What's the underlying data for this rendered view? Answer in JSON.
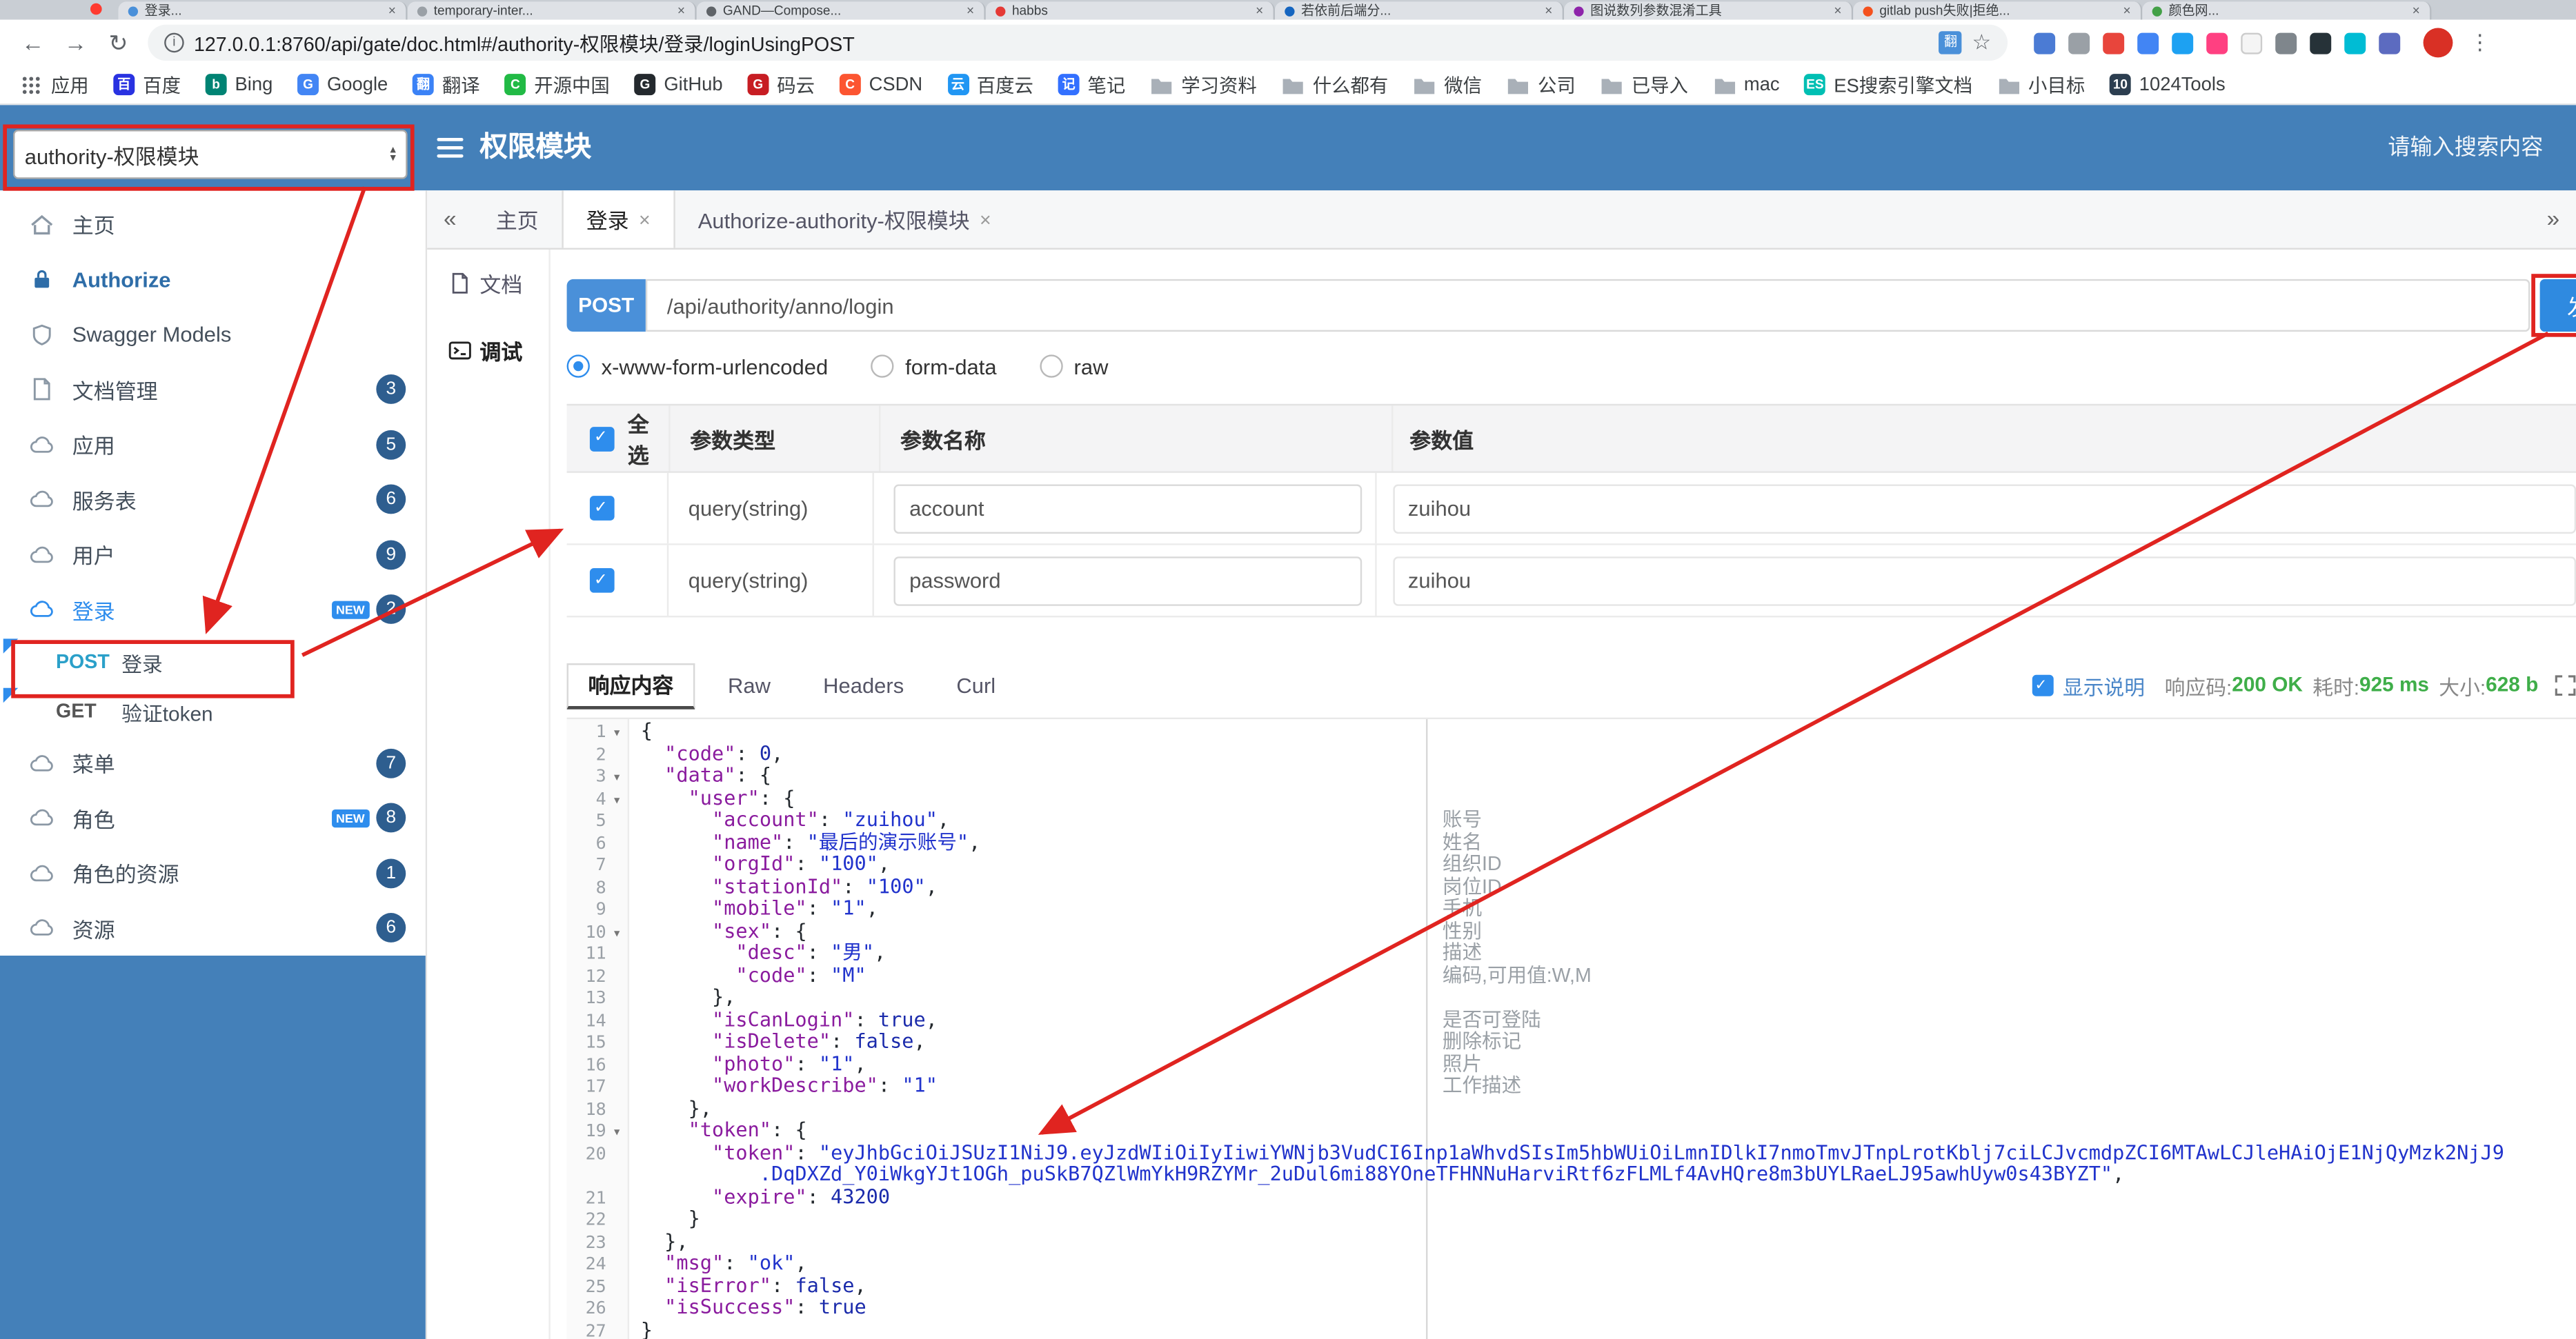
{
  "browser": {
    "tab_strip": [
      {
        "title": "登录...",
        "color": "#4a90d9"
      },
      {
        "title": "temporary-inter...",
        "color": "#9aa0a6"
      },
      {
        "title": "GAND—Compose...",
        "color": "#5f6368"
      },
      {
        "title": "habbs",
        "color": "#e53935"
      },
      {
        "title": "若依前后端分...",
        "color": "#1565c0"
      },
      {
        "title": "图说数列参数混淆工具",
        "color": "#8e24aa"
      },
      {
        "title": "gitlab push失败|拒绝...",
        "color": "#f4511e"
      },
      {
        "title": "颜色网...",
        "color": "#43a047"
      }
    ],
    "close_glyph": "×",
    "url": "127.0.0.1:8760/api/gate/doc.html#/authority-权限模块/登录/loginUsingPOST",
    "bookmarks": [
      {
        "icon": "grid",
        "label": "应用"
      },
      {
        "icon": "letter",
        "letter": "百",
        "color": "#2932e1",
        "label": "百度"
      },
      {
        "icon": "letter",
        "letter": "b",
        "color": "#008373",
        "label": "Bing"
      },
      {
        "icon": "letter",
        "letter": "G",
        "color": "#4285f4",
        "label": "Google"
      },
      {
        "icon": "letter",
        "letter": "翻",
        "color": "#3b82f6",
        "label": "翻译"
      },
      {
        "icon": "letter",
        "letter": "C",
        "color": "#21ba45",
        "label": "开源中国"
      },
      {
        "icon": "letter",
        "letter": "G",
        "color": "#24292e",
        "label": "GitHub"
      },
      {
        "icon": "letter",
        "letter": "G",
        "color": "#c71d23",
        "label": "码云"
      },
      {
        "icon": "letter",
        "letter": "C",
        "color": "#fc5531",
        "label": "CSDN"
      },
      {
        "icon": "letter",
        "letter": "云",
        "color": "#2196f3",
        "label": "百度云"
      },
      {
        "icon": "letter",
        "letter": "记",
        "color": "#3370ff",
        "label": "笔记"
      },
      {
        "icon": "folder",
        "label": "学习资料"
      },
      {
        "icon": "folder",
        "label": "什么都有"
      },
      {
        "icon": "folder",
        "label": "微信"
      },
      {
        "icon": "folder",
        "label": "公司"
      },
      {
        "icon": "folder",
        "label": "已导入"
      },
      {
        "icon": "folder",
        "label": "mac"
      },
      {
        "icon": "letter",
        "letter": "ES",
        "color": "#00bfb3",
        "label": "ES搜索引擎文档"
      },
      {
        "icon": "folder",
        "label": "小目标"
      },
      {
        "icon": "letter",
        "letter": "10",
        "color": "#2c3e50",
        "label": "1024Tools"
      }
    ],
    "extensions": [
      "#4b7bd4",
      "#9aa0a6",
      "#e8453c",
      "#4285f4",
      "#1da1f2",
      "#ff4081",
      "#f5f5f5",
      "#7f868c",
      "#263238",
      "#00bcd4",
      "#5c6bc0"
    ]
  },
  "header": {
    "module_select": "authority-权限模块",
    "title": "权限模块",
    "search_placeholder": "请输入搜索内容"
  },
  "sidebar": {
    "new_label": "NEW",
    "items": [
      {
        "icon": "home",
        "label": "主页"
      },
      {
        "icon": "lock",
        "label": "Authorize",
        "style": "auth"
      },
      {
        "icon": "shield",
        "label": "Swagger Models"
      },
      {
        "icon": "doc",
        "label": "文档管理",
        "badge": "3"
      },
      {
        "icon": "cloud",
        "label": "应用",
        "badge": "5"
      },
      {
        "icon": "cloud",
        "label": "服务表",
        "badge": "6"
      },
      {
        "icon": "cloud",
        "label": "用户",
        "badge": "9"
      },
      {
        "icon": "cloud",
        "label": "登录",
        "badge": "2",
        "new": true,
        "active": true
      },
      {
        "method": "POST",
        "label": "登录",
        "flag": true,
        "boxed": true
      },
      {
        "method": "GET",
        "label": "验证token",
        "flag": true
      },
      {
        "icon": "cloud",
        "label": "菜单",
        "badge": "7"
      },
      {
        "icon": "cloud",
        "label": "角色",
        "badge": "8",
        "new": true
      },
      {
        "icon": "cloud",
        "label": "角色的资源",
        "badge": "1"
      },
      {
        "icon": "cloud",
        "label": "资源",
        "badge": "6"
      }
    ]
  },
  "tabs": {
    "left_arrow": "«",
    "right_arrow": "»",
    "close_glyph": "×",
    "items": [
      {
        "label": "主页"
      },
      {
        "label": "登录",
        "closable": true,
        "active": true
      },
      {
        "label": "Authorize-authority-权限模块",
        "closable": true
      }
    ]
  },
  "view_tabs": {
    "doc": "文档",
    "debug": "调试"
  },
  "request": {
    "method": "POST",
    "url": "/api/authority/anno/login",
    "send_label": "发送",
    "content_types": [
      {
        "label": "x-www-form-urlencoded",
        "selected": true
      },
      {
        "label": "form-data"
      },
      {
        "label": "raw"
      }
    ]
  },
  "params": {
    "headers": {
      "all": "全选",
      "type": "参数类型",
      "name": "参数名称",
      "value": "参数值"
    },
    "rows": [
      {
        "checked": true,
        "type": "query(string)",
        "name": "account",
        "value": "zuihou"
      },
      {
        "checked": true,
        "type": "query(string)",
        "name": "password",
        "value": "zuihou"
      }
    ]
  },
  "response": {
    "tabs": [
      {
        "label": "响应内容",
        "active": true
      },
      {
        "label": "Raw"
      },
      {
        "label": "Headers"
      },
      {
        "label": "Curl"
      }
    ],
    "show_desc": "显示说明",
    "meta": [
      {
        "label": "响应码:",
        "value": "200 OK"
      },
      {
        "label": "耗时:",
        "value": "925 ms"
      },
      {
        "label": "大小:",
        "value": "628 b"
      }
    ]
  },
  "code": {
    "fold_glyph": "▾",
    "rows": [
      {
        "ln": "1",
        "fold": true,
        "segs": [
          [
            "p",
            "{"
          ]
        ]
      },
      {
        "ln": "2",
        "segs": [
          [
            "p",
            "  "
          ],
          [
            "k",
            "\"code\""
          ],
          [
            "p",
            ": "
          ],
          [
            "n",
            "0"
          ],
          [
            "p",
            ","
          ]
        ]
      },
      {
        "ln": "3",
        "fold": true,
        "segs": [
          [
            "p",
            "  "
          ],
          [
            "k",
            "\"data\""
          ],
          [
            "p",
            ": {"
          ]
        ]
      },
      {
        "ln": "4",
        "fold": true,
        "segs": [
          [
            "p",
            "    "
          ],
          [
            "k",
            "\"user\""
          ],
          [
            "p",
            ": {"
          ]
        ]
      },
      {
        "ln": "5",
        "anno": "账号",
        "segs": [
          [
            "p",
            "      "
          ],
          [
            "k",
            "\"account\""
          ],
          [
            "p",
            ": "
          ],
          [
            "s",
            "\"zuihou\""
          ],
          [
            "p",
            ","
          ]
        ]
      },
      {
        "ln": "6",
        "anno": "姓名",
        "segs": [
          [
            "p",
            "      "
          ],
          [
            "k",
            "\"name\""
          ],
          [
            "p",
            ": "
          ],
          [
            "s",
            "\"最后的演示账号\""
          ],
          [
            "p",
            ","
          ]
        ]
      },
      {
        "ln": "7",
        "anno": "组织ID",
        "segs": [
          [
            "p",
            "      "
          ],
          [
            "k",
            "\"orgId\""
          ],
          [
            "p",
            ": "
          ],
          [
            "s",
            "\"100\""
          ],
          [
            "p",
            ","
          ]
        ]
      },
      {
        "ln": "8",
        "anno": "岗位ID",
        "segs": [
          [
            "p",
            "      "
          ],
          [
            "k",
            "\"stationId\""
          ],
          [
            "p",
            ": "
          ],
          [
            "s",
            "\"100\""
          ],
          [
            "p",
            ","
          ]
        ]
      },
      {
        "ln": "9",
        "anno": "手机",
        "segs": [
          [
            "p",
            "      "
          ],
          [
            "k",
            "\"mobile\""
          ],
          [
            "p",
            ": "
          ],
          [
            "s",
            "\"1\""
          ],
          [
            "p",
            ","
          ]
        ]
      },
      {
        "ln": "10",
        "fold": true,
        "anno": "性别",
        "segs": [
          [
            "p",
            "      "
          ],
          [
            "k",
            "\"sex\""
          ],
          [
            "p",
            ": {"
          ]
        ]
      },
      {
        "ln": "11",
        "anno": "描述",
        "segs": [
          [
            "p",
            "        "
          ],
          [
            "k",
            "\"desc\""
          ],
          [
            "p",
            ": "
          ],
          [
            "s",
            "\"男\""
          ],
          [
            "p",
            ","
          ]
        ]
      },
      {
        "ln": "12",
        "anno": "编码,可用值:W,M",
        "segs": [
          [
            "p",
            "        "
          ],
          [
            "k",
            "\"code\""
          ],
          [
            "p",
            ": "
          ],
          [
            "s",
            "\"M\""
          ]
        ]
      },
      {
        "ln": "13",
        "segs": [
          [
            "p",
            "      },"
          ]
        ]
      },
      {
        "ln": "14",
        "anno": "是否可登陆",
        "segs": [
          [
            "p",
            "      "
          ],
          [
            "k",
            "\"isCanLogin\""
          ],
          [
            "p",
            ": "
          ],
          [
            "b",
            "true"
          ],
          [
            "p",
            ","
          ]
        ]
      },
      {
        "ln": "15",
        "anno": "删除标记",
        "segs": [
          [
            "p",
            "      "
          ],
          [
            "k",
            "\"isDelete\""
          ],
          [
            "p",
            ": "
          ],
          [
            "b",
            "false"
          ],
          [
            "p",
            ","
          ]
        ]
      },
      {
        "ln": "16",
        "anno": "照片",
        "segs": [
          [
            "p",
            "      "
          ],
          [
            "k",
            "\"photo\""
          ],
          [
            "p",
            ": "
          ],
          [
            "s",
            "\"1\""
          ],
          [
            "p",
            ","
          ]
        ]
      },
      {
        "ln": "17",
        "anno": "工作描述",
        "segs": [
          [
            "p",
            "      "
          ],
          [
            "k",
            "\"workDescribe\""
          ],
          [
            "p",
            ": "
          ],
          [
            "s",
            "\"1\""
          ]
        ]
      },
      {
        "ln": "18",
        "segs": [
          [
            "p",
            "    },"
          ]
        ]
      },
      {
        "ln": "19",
        "fold": true,
        "segs": [
          [
            "p",
            "    "
          ],
          [
            "k",
            "\"token\""
          ],
          [
            "p",
            ": {"
          ]
        ]
      },
      {
        "ln": "20",
        "segs": [
          [
            "p",
            "      "
          ],
          [
            "k",
            "\"token\""
          ],
          [
            "p",
            ": "
          ],
          [
            "s",
            "\"eyJhbGciOiJSUzI1NiJ9.eyJzdWIiOiIyIiwiYWNjb3VudCI6Inp1aWhvdSIsIm5hbWUiOiLmnIDlkI7nmoTmvJTnpLrotKblj7ciLCJvcmdpZCI6MTAwLCJleHAiOjE1NjQyMzk2NjJ9"
          ]
        ]
      },
      {
        "ln": "",
        "segs": [
          [
            "p",
            "          "
          ],
          [
            "s",
            ".DqDXZd_Y0iWkgYJt1OGh_puSkB7QZlWmYkH9RZYMr_2uDul6mi88YOneTFHNNuHarviRtf6zFLMLf4AvHQre8m3bUYLRaeLJ95awhUyw0s43BYZT\""
          ],
          [
            "p",
            ","
          ]
        ]
      },
      {
        "ln": "21",
        "segs": [
          [
            "p",
            "      "
          ],
          [
            "k",
            "\"expire\""
          ],
          [
            "p",
            ": "
          ],
          [
            "n",
            "43200"
          ]
        ]
      },
      {
        "ln": "22",
        "segs": [
          [
            "p",
            "    }"
          ]
        ]
      },
      {
        "ln": "23",
        "segs": [
          [
            "p",
            "  },"
          ]
        ]
      },
      {
        "ln": "24",
        "segs": [
          [
            "p",
            "  "
          ],
          [
            "k",
            "\"msg\""
          ],
          [
            "p",
            ": "
          ],
          [
            "s",
            "\"ok\""
          ],
          [
            "p",
            ","
          ]
        ]
      },
      {
        "ln": "25",
        "segs": [
          [
            "p",
            "  "
          ],
          [
            "k",
            "\"isError\""
          ],
          [
            "p",
            ": "
          ],
          [
            "b",
            "false"
          ],
          [
            "p",
            ","
          ]
        ]
      },
      {
        "ln": "26",
        "segs": [
          [
            "p",
            "  "
          ],
          [
            "k",
            "\"isSuccess\""
          ],
          [
            "p",
            ": "
          ],
          [
            "b",
            "true"
          ]
        ]
      },
      {
        "ln": "27",
        "segs": [
          [
            "p",
            "}"
          ]
        ]
      }
    ]
  },
  "colors": {
    "header_blue": "#4480b9",
    "accent_blue": "#2e8ded",
    "method_badge": "#4a90d9",
    "success_green": "#3fae49",
    "annotation_red": "#e02420"
  }
}
